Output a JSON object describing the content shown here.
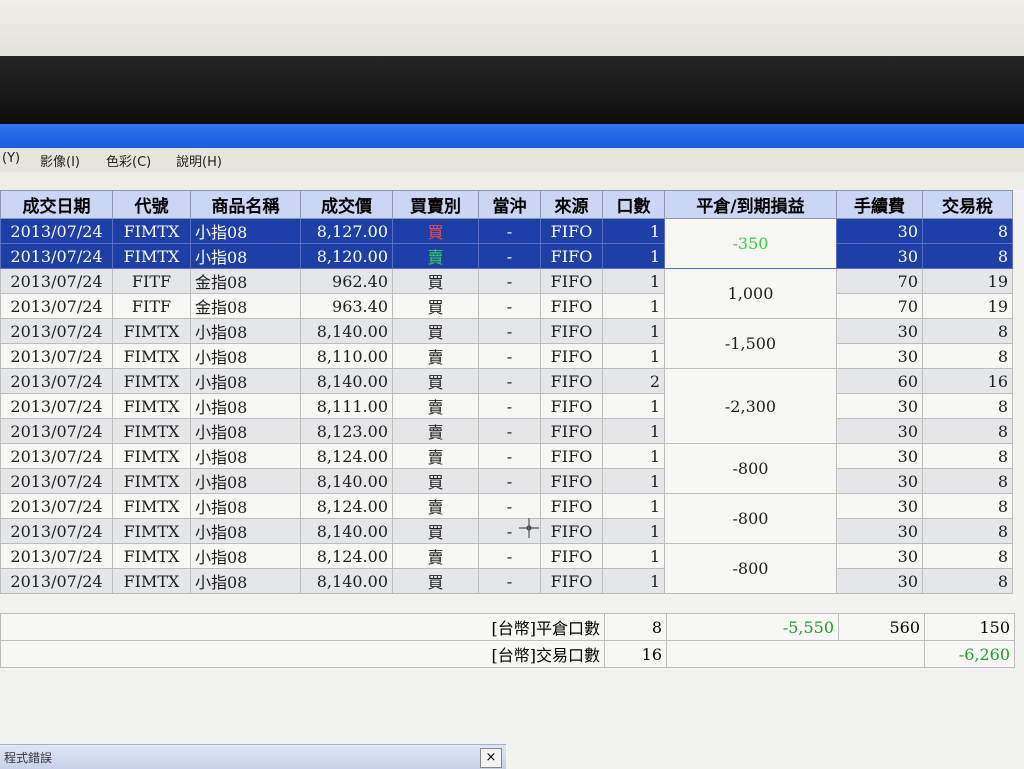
{
  "menu": [
    "(Y)",
    "影像(I)",
    "色彩(C)",
    "說明(H)"
  ],
  "headers": [
    "成交日期",
    "代號",
    "商品名稱",
    "成交價",
    "買賣別",
    "當沖",
    "來源",
    "口數",
    "平倉/到期損益",
    "手續費",
    "交易稅"
  ],
  "rows": [
    {
      "date": "2013/07/24",
      "code": "FIMTX",
      "name": "小指08",
      "price": "8,127.00",
      "side": "買",
      "day": "-",
      "src": "FIFO",
      "qty": "1",
      "fee": "30",
      "tax": "8"
    },
    {
      "date": "2013/07/24",
      "code": "FIMTX",
      "name": "小指08",
      "price": "8,120.00",
      "side": "賣",
      "day": "-",
      "src": "FIFO",
      "qty": "1",
      "fee": "30",
      "tax": "8"
    },
    {
      "date": "2013/07/24",
      "code": "FITF",
      "name": "金指08",
      "price": "962.40",
      "side": "買",
      "day": "-",
      "src": "FIFO",
      "qty": "1",
      "fee": "70",
      "tax": "19"
    },
    {
      "date": "2013/07/24",
      "code": "FITF",
      "name": "金指08",
      "price": "963.40",
      "side": "買",
      "day": "-",
      "src": "FIFO",
      "qty": "1",
      "fee": "70",
      "tax": "19"
    },
    {
      "date": "2013/07/24",
      "code": "FIMTX",
      "name": "小指08",
      "price": "8,140.00",
      "side": "買",
      "day": "-",
      "src": "FIFO",
      "qty": "1",
      "fee": "30",
      "tax": "8"
    },
    {
      "date": "2013/07/24",
      "code": "FIMTX",
      "name": "小指08",
      "price": "8,110.00",
      "side": "賣",
      "day": "-",
      "src": "FIFO",
      "qty": "1",
      "fee": "30",
      "tax": "8"
    },
    {
      "date": "2013/07/24",
      "code": "FIMTX",
      "name": "小指08",
      "price": "8,140.00",
      "side": "買",
      "day": "-",
      "src": "FIFO",
      "qty": "2",
      "fee": "60",
      "tax": "16"
    },
    {
      "date": "2013/07/24",
      "code": "FIMTX",
      "name": "小指08",
      "price": "8,111.00",
      "side": "賣",
      "day": "-",
      "src": "FIFO",
      "qty": "1",
      "fee": "30",
      "tax": "8"
    },
    {
      "date": "2013/07/24",
      "code": "FIMTX",
      "name": "小指08",
      "price": "8,123.00",
      "side": "賣",
      "day": "-",
      "src": "FIFO",
      "qty": "1",
      "fee": "30",
      "tax": "8"
    },
    {
      "date": "2013/07/24",
      "code": "FIMTX",
      "name": "小指08",
      "price": "8,124.00",
      "side": "賣",
      "day": "-",
      "src": "FIFO",
      "qty": "1",
      "fee": "30",
      "tax": "8"
    },
    {
      "date": "2013/07/24",
      "code": "FIMTX",
      "name": "小指08",
      "price": "8,140.00",
      "side": "買",
      "day": "-",
      "src": "FIFO",
      "qty": "1",
      "fee": "30",
      "tax": "8"
    },
    {
      "date": "2013/07/24",
      "code": "FIMTX",
      "name": "小指08",
      "price": "8,124.00",
      "side": "賣",
      "day": "-",
      "src": "FIFO",
      "qty": "1",
      "fee": "30",
      "tax": "8"
    },
    {
      "date": "2013/07/24",
      "code": "FIMTX",
      "name": "小指08",
      "price": "8,140.00",
      "side": "買",
      "day": "-",
      "src": "FIFO",
      "qty": "1",
      "fee": "30",
      "tax": "8"
    },
    {
      "date": "2013/07/24",
      "code": "FIMTX",
      "name": "小指08",
      "price": "8,124.00",
      "side": "賣",
      "day": "-",
      "src": "FIFO",
      "qty": "1",
      "fee": "30",
      "tax": "8"
    },
    {
      "date": "2013/07/24",
      "code": "FIMTX",
      "name": "小指08",
      "price": "8,140.00",
      "side": "買",
      "day": "-",
      "src": "FIFO",
      "qty": "1",
      "fee": "30",
      "tax": "8"
    }
  ],
  "pl": [
    "-350",
    "1,000",
    "-1,500",
    "-2,300",
    "-800",
    "-800",
    "-800"
  ],
  "totals": {
    "close_label": "[台幣]平倉口數",
    "close_qty": "8",
    "close_pl": "-5,550",
    "close_fee": "560",
    "close_tax": "150",
    "trade_label": "[台幣]交易口數",
    "trade_qty": "16",
    "trade_net": "-6,260"
  },
  "error_title": "程式錯誤",
  "close_icon": "×"
}
